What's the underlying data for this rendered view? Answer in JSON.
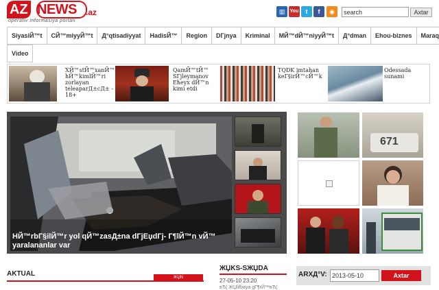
{
  "logo": {
    "az": "AZ",
    "news": "NEWS",
    "dotaz": ".az",
    "tagline": "operativ informasiya portalı"
  },
  "header": {
    "social": [
      {
        "name": "rss-blue-icon",
        "glyph": "▥"
      },
      {
        "name": "youtube-icon",
        "glyph": "You"
      },
      {
        "name": "twitter-icon",
        "glyph": "t"
      },
      {
        "name": "facebook-icon",
        "glyph": "f"
      },
      {
        "name": "rss-icon",
        "glyph": "◉"
      }
    ],
    "search_value": "search",
    "search_button": "Axtar"
  },
  "nav": {
    "row1": [
      "SiyasiЙ™t",
      "CЙ™miyyЙ™t",
      "Д°qtisadiyyat",
      "HadisЙ™",
      "Region",
      "DГјnya",
      "Kriminal",
      "MЙ™dЙ™niyyЙ™t",
      "Д°dman",
      "Ehou-biznes",
      "MaraqlД±"
    ],
    "row2": [
      "Video"
    ]
  },
  "strip": [
    {
      "text": "XЙ™stЙ™xanЙ™dЙ™ hЙ™kimlЙ™ri zorlayan teleaparД±cД± - 18+"
    },
    {
      "text": "QamЙ™tЙ™ SГјleymanov Ећeyx dЙ™n kimi etdi"
    },
    {
      "text": "TQDK imtahan keГ§irЙ™cЙ™k"
    },
    {
      "text": "Odessada sunami"
    }
  ],
  "feature": {
    "caption": "HЙ™rbГ§ilЙ™r yol qЙ™zasД±na dГјЕџdГј- Г¶lЙ™n vЙ™ yaralananlar var"
  },
  "bottom": {
    "aktual": "AKTUAL",
    "red_tag": "ЖЏN ЖЏHЖЏMIYYЖЏTLI",
    "mid_title": "ЖЏKS-SЖЏDA",
    "mid_date": "27-05-10 23:20",
    "mid_sub": "вЂ¦ ЖЏlifbaya gГ¶rЙ™вЂ¦",
    "archive_label": "ARXД°V:",
    "archive_value": "2013-05-10",
    "archive_button": "Axtar"
  }
}
